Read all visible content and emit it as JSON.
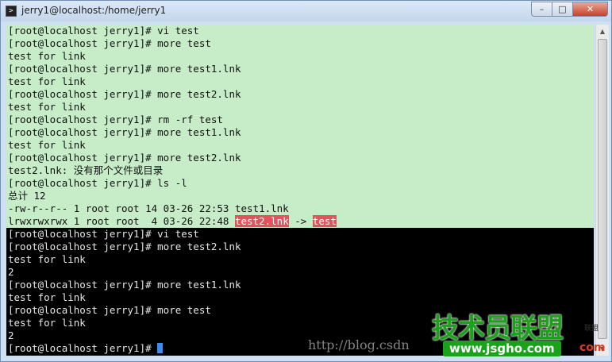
{
  "window": {
    "title": "jerry1@localhost:/home/jerry1",
    "buttons": {
      "minimize": "–",
      "maximize": "□",
      "close": "✕"
    }
  },
  "terminal": {
    "top_lines": [
      "[root@localhost jerry1]# vi test",
      "[root@localhost jerry1]# more test",
      "test for link",
      "[root@localhost jerry1]# more test1.lnk",
      "test for link",
      "[root@localhost jerry1]# more test2.lnk",
      "test for link",
      "[root@localhost jerry1]# rm -rf test",
      "[root@localhost jerry1]# more test1.lnk",
      "test for link",
      "[root@localhost jerry1]# more test2.lnk",
      "test2.lnk: 没有那个文件或目录",
      "[root@localhost jerry1]# ls -l",
      "总计 12",
      "-rw-r--r-- 1 root root 14 03-26 22:53 test1.lnk"
    ],
    "ls_symlink_line": {
      "prefix": "lrwxrwxrwx 1 root root  4 03-26 22:48 ",
      "link_name": "test2.lnk",
      "arrow": " -> ",
      "target": "test"
    },
    "bottom_lines": [
      "[root@localhost jerry1]# vi test",
      "[root@localhost jerry1]# more test2.lnk",
      "test for link",
      "2",
      "",
      "[root@localhost jerry1]# more test1.lnk",
      "test for link",
      "[root@localhost jerry1]# more test",
      "test for link",
      "2"
    ],
    "prompt": "[root@localhost jerry1]# ",
    "colors": {
      "top_background": "#c7ecc8",
      "bottom_background": "#000000",
      "highlight": "#e8505b",
      "cursor": "#3c8cf0"
    }
  },
  "watermark": {
    "url_text": "http://blog.csdn",
    "logo_cn": "技术员联盟",
    "logo_domain": "www.jsgho.com",
    "logo_small": "联盟",
    "logo_com": "com"
  }
}
